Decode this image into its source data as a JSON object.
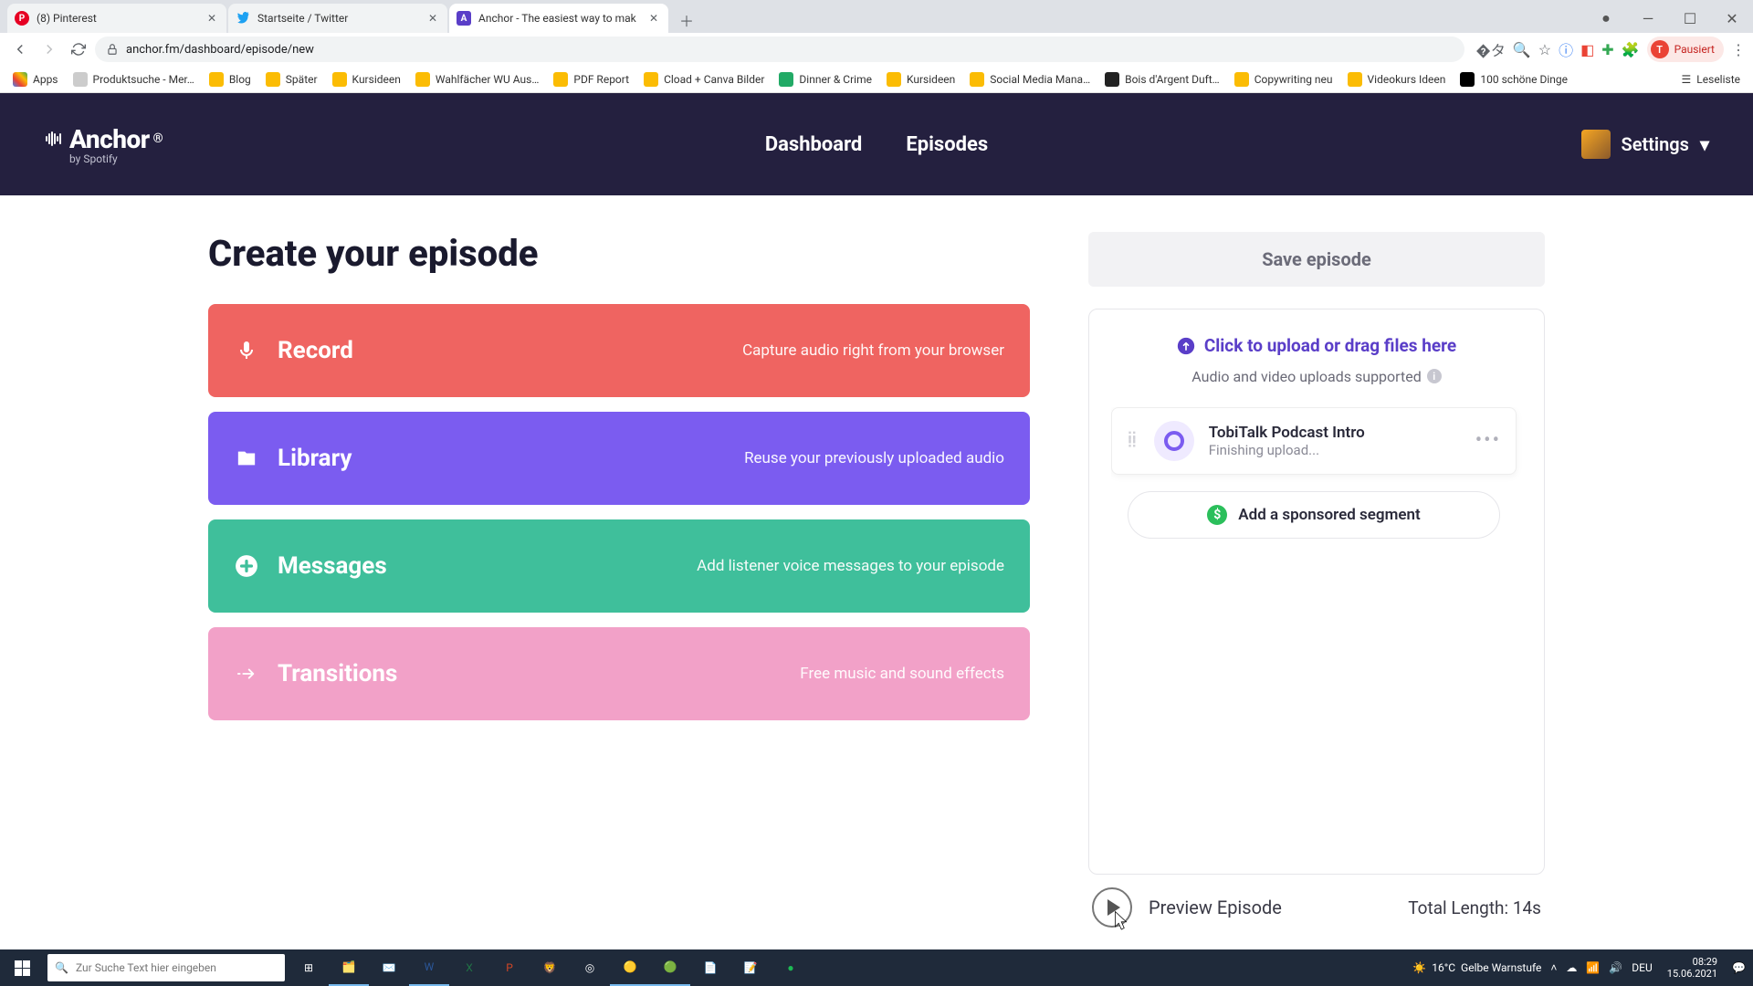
{
  "browser": {
    "tabs": [
      {
        "title": "(8) Pinterest",
        "favicon_color": "#e60023"
      },
      {
        "title": "Startseite / Twitter",
        "favicon_color": "#1da1f2"
      },
      {
        "title": "Anchor - The easiest way to mak",
        "favicon_color": "#5a3ec8"
      }
    ],
    "url": "anchor.fm/dashboard/episode/new",
    "profile_label": "Pausiert",
    "profile_initial": "T",
    "bookmarks": [
      "Apps",
      "Produktsuche - Mer…",
      "Blog",
      "Später",
      "Kursideen",
      "Wahlfächer WU Aus…",
      "PDF Report",
      "Cload + Canva Bilder",
      "Dinner & Crime",
      "Kursideen",
      "Social Media Mana…",
      "Bois d'Argent Duft…",
      "Copywriting neu",
      "Videokurs Ideen",
      "100 schöne Dinge"
    ],
    "reading_list": "Leseliste"
  },
  "anchor": {
    "logo_main": "Anchor",
    "logo_sub": "by Spotify",
    "nav": {
      "dashboard": "Dashboard",
      "episodes": "Episodes"
    },
    "settings": "Settings",
    "page_title": "Create your episode",
    "cards": {
      "record": {
        "title": "Record",
        "desc": "Capture audio right from your browser"
      },
      "library": {
        "title": "Library",
        "desc": "Reuse your previously uploaded audio"
      },
      "messages": {
        "title": "Messages",
        "desc": "Add listener voice messages to your episode"
      },
      "transitions": {
        "title": "Transitions",
        "desc": "Free music and sound effects"
      }
    },
    "save_label": "Save episode",
    "upload_cta": "Click to upload or drag files here",
    "upload_sub": "Audio and video uploads supported",
    "segment": {
      "title": "TobiTalk Podcast Intro",
      "status": "Finishing upload..."
    },
    "sponsored": "Add a sponsored segment",
    "preview_label": "Preview Episode",
    "total_prefix": "Total Length: ",
    "total_value": "14s"
  },
  "taskbar": {
    "search_placeholder": "Zur Suche Text hier eingeben",
    "weather_temp": "16°C",
    "weather_label": "Gelbe Warnstufe",
    "lang": "DEU",
    "time": "08:29",
    "date": "15.06.2021"
  }
}
